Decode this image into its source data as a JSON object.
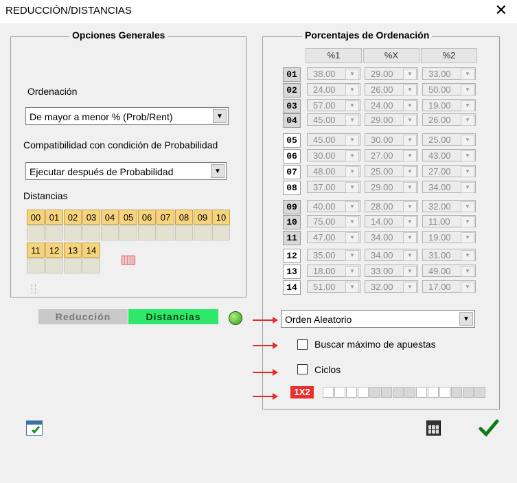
{
  "window": {
    "title": "REDUCCIÓN/DISTANCIAS",
    "close_icon": "✕"
  },
  "general": {
    "legend": "Opciones Generales",
    "ordenacion_label": "Ordenación",
    "ordenacion_value": "De mayor a menor % (Prob/Rent)",
    "compat_label": "Compatibilidad con condición de Probabilidad",
    "compat_value": "Ejecutar después de Probabilidad",
    "distancias_label": "Distancias",
    "distancias_row1": [
      "00",
      "01",
      "02",
      "03",
      "04",
      "05",
      "06",
      "07",
      "08",
      "09",
      "10"
    ],
    "distancias_row2": [
      "11",
      "12",
      "13",
      "14"
    ]
  },
  "porcentajes": {
    "legend": "Porcentajes de Ordenación",
    "headers": [
      "%1",
      "%X",
      "%2"
    ],
    "rows": [
      {
        "id": "01",
        "v": [
          "38.00",
          "29.00",
          "33.00"
        ]
      },
      {
        "id": "02",
        "v": [
          "24.00",
          "26.00",
          "50.00"
        ]
      },
      {
        "id": "03",
        "v": [
          "57.00",
          "24.00",
          "19.00"
        ]
      },
      {
        "id": "04",
        "v": [
          "45.00",
          "29.00",
          "26.00"
        ]
      },
      {
        "id": "05",
        "v": [
          "45.00",
          "30.00",
          "25.00"
        ]
      },
      {
        "id": "06",
        "v": [
          "30.00",
          "27.00",
          "43.00"
        ]
      },
      {
        "id": "07",
        "v": [
          "48.00",
          "25.00",
          "27.00"
        ]
      },
      {
        "id": "08",
        "v": [
          "37.00",
          "29.00",
          "34.00"
        ]
      },
      {
        "id": "09",
        "v": [
          "40.00",
          "28.00",
          "32.00"
        ]
      },
      {
        "id": "10",
        "v": [
          "75.00",
          "14.00",
          "11.00"
        ]
      },
      {
        "id": "11",
        "v": [
          "47.00",
          "34.00",
          "19.00"
        ]
      },
      {
        "id": "12",
        "v": [
          "35.00",
          "34.00",
          "31.00"
        ]
      },
      {
        "id": "13",
        "v": [
          "18.00",
          "33.00",
          "49.00"
        ]
      },
      {
        "id": "14",
        "v": [
          "51.00",
          "32.00",
          "17.00"
        ]
      }
    ],
    "orden_value": "Orden Aleatorio",
    "buscar_label": "Buscar máximo de apuestas",
    "ciclos_label": "Ciclos",
    "badge": "1X2"
  },
  "tabs": {
    "reduccion": "Reducción",
    "distancias": "Distancias"
  },
  "colors": {
    "tab_active": "#2ee86a",
    "dist_cell": "#f6d37e",
    "arrow": "#e32b2b",
    "badge": "#e83030"
  }
}
